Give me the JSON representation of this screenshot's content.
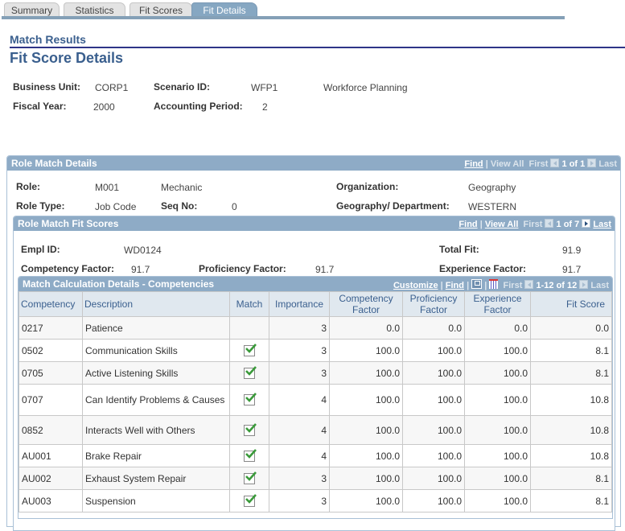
{
  "tabs": [
    {
      "label": "Summary",
      "active": false
    },
    {
      "label": "Statistics",
      "active": false
    },
    {
      "label": "Fit Scores",
      "active": false
    },
    {
      "label": "Fit Details",
      "active": true
    }
  ],
  "header": {
    "section": "Match Results",
    "title": "Fit Score Details"
  },
  "summary": {
    "business_unit_label": "Business Unit:",
    "business_unit": "CORP1",
    "scenario_id_label": "Scenario ID:",
    "scenario_id": "WFP1",
    "scenario_desc": "Workforce Planning",
    "fiscal_year_label": "Fiscal Year:",
    "fiscal_year": "2000",
    "accounting_period_label": "Accounting Period:",
    "accounting_period": "2"
  },
  "role_match": {
    "title": "Role Match Details",
    "nav": {
      "find": "Find",
      "sep": "|",
      "view_all": "View All",
      "first": "First",
      "count": "1 of 1",
      "last": "Last"
    },
    "role_label": "Role:",
    "role": "M001",
    "role_desc": "Mechanic",
    "role_type_label": "Role Type:",
    "role_type": "Job Code",
    "seq_label": "Seq No:",
    "seq": "0",
    "org_label": "Organization:",
    "org": "Geography",
    "geo_label": "Geography/ Department:",
    "geo": "WESTERN"
  },
  "fit_scores": {
    "title": "Role Match Fit Scores",
    "nav": {
      "find": "Find",
      "sep": "|",
      "view_all": "View All",
      "first": "First",
      "count": "1 of 7",
      "last": "Last"
    },
    "empl_label": "Empl ID:",
    "empl": "WD0124",
    "total_label": "Total Fit:",
    "total": "91.9",
    "comp_label": "Competency Factor:",
    "comp": "91.7",
    "prof_label": "Proficiency Factor:",
    "prof": "91.7",
    "exp_label": "Experience Factor:",
    "exp": "91.7"
  },
  "calc": {
    "title": "Match Calculation Details - Competencies",
    "nav": {
      "customize": "Customize",
      "sep": "|",
      "find": "Find",
      "first": "First",
      "count": "1-12 of 12",
      "last": "Last"
    },
    "columns": [
      "Competency",
      "Description",
      "Match",
      "Importance",
      "Competency Factor",
      "Proficiency Factor",
      "Experience Factor",
      "Fit Score"
    ],
    "rows": [
      {
        "code": "0217",
        "desc": "Patience",
        "match": false,
        "importance": "3",
        "comp": "0.0",
        "prof": "0.0",
        "exp": "0.0",
        "fit": "0.0"
      },
      {
        "code": "0502",
        "desc": "Communication Skills",
        "match": true,
        "importance": "3",
        "comp": "100.0",
        "prof": "100.0",
        "exp": "100.0",
        "fit": "8.1"
      },
      {
        "code": "0705",
        "desc": "Active Listening Skills",
        "match": true,
        "importance": "3",
        "comp": "100.0",
        "prof": "100.0",
        "exp": "100.0",
        "fit": "8.1"
      },
      {
        "code": "0707",
        "desc": "Can Identify Problems & Causes",
        "match": true,
        "importance": "4",
        "comp": "100.0",
        "prof": "100.0",
        "exp": "100.0",
        "fit": "10.8"
      },
      {
        "code": "0852",
        "desc": "Interacts Well with Others",
        "match": true,
        "importance": "4",
        "comp": "100.0",
        "prof": "100.0",
        "exp": "100.0",
        "fit": "10.8"
      },
      {
        "code": "AU001",
        "desc": "Brake Repair",
        "match": true,
        "importance": "4",
        "comp": "100.0",
        "prof": "100.0",
        "exp": "100.0",
        "fit": "10.8"
      },
      {
        "code": "AU002",
        "desc": "Exhaust System Repair",
        "match": true,
        "importance": "3",
        "comp": "100.0",
        "prof": "100.0",
        "exp": "100.0",
        "fit": "8.1"
      },
      {
        "code": "AU003",
        "desc": "Suspension",
        "match": true,
        "importance": "3",
        "comp": "100.0",
        "prof": "100.0",
        "exp": "100.0",
        "fit": "8.1"
      }
    ]
  }
}
